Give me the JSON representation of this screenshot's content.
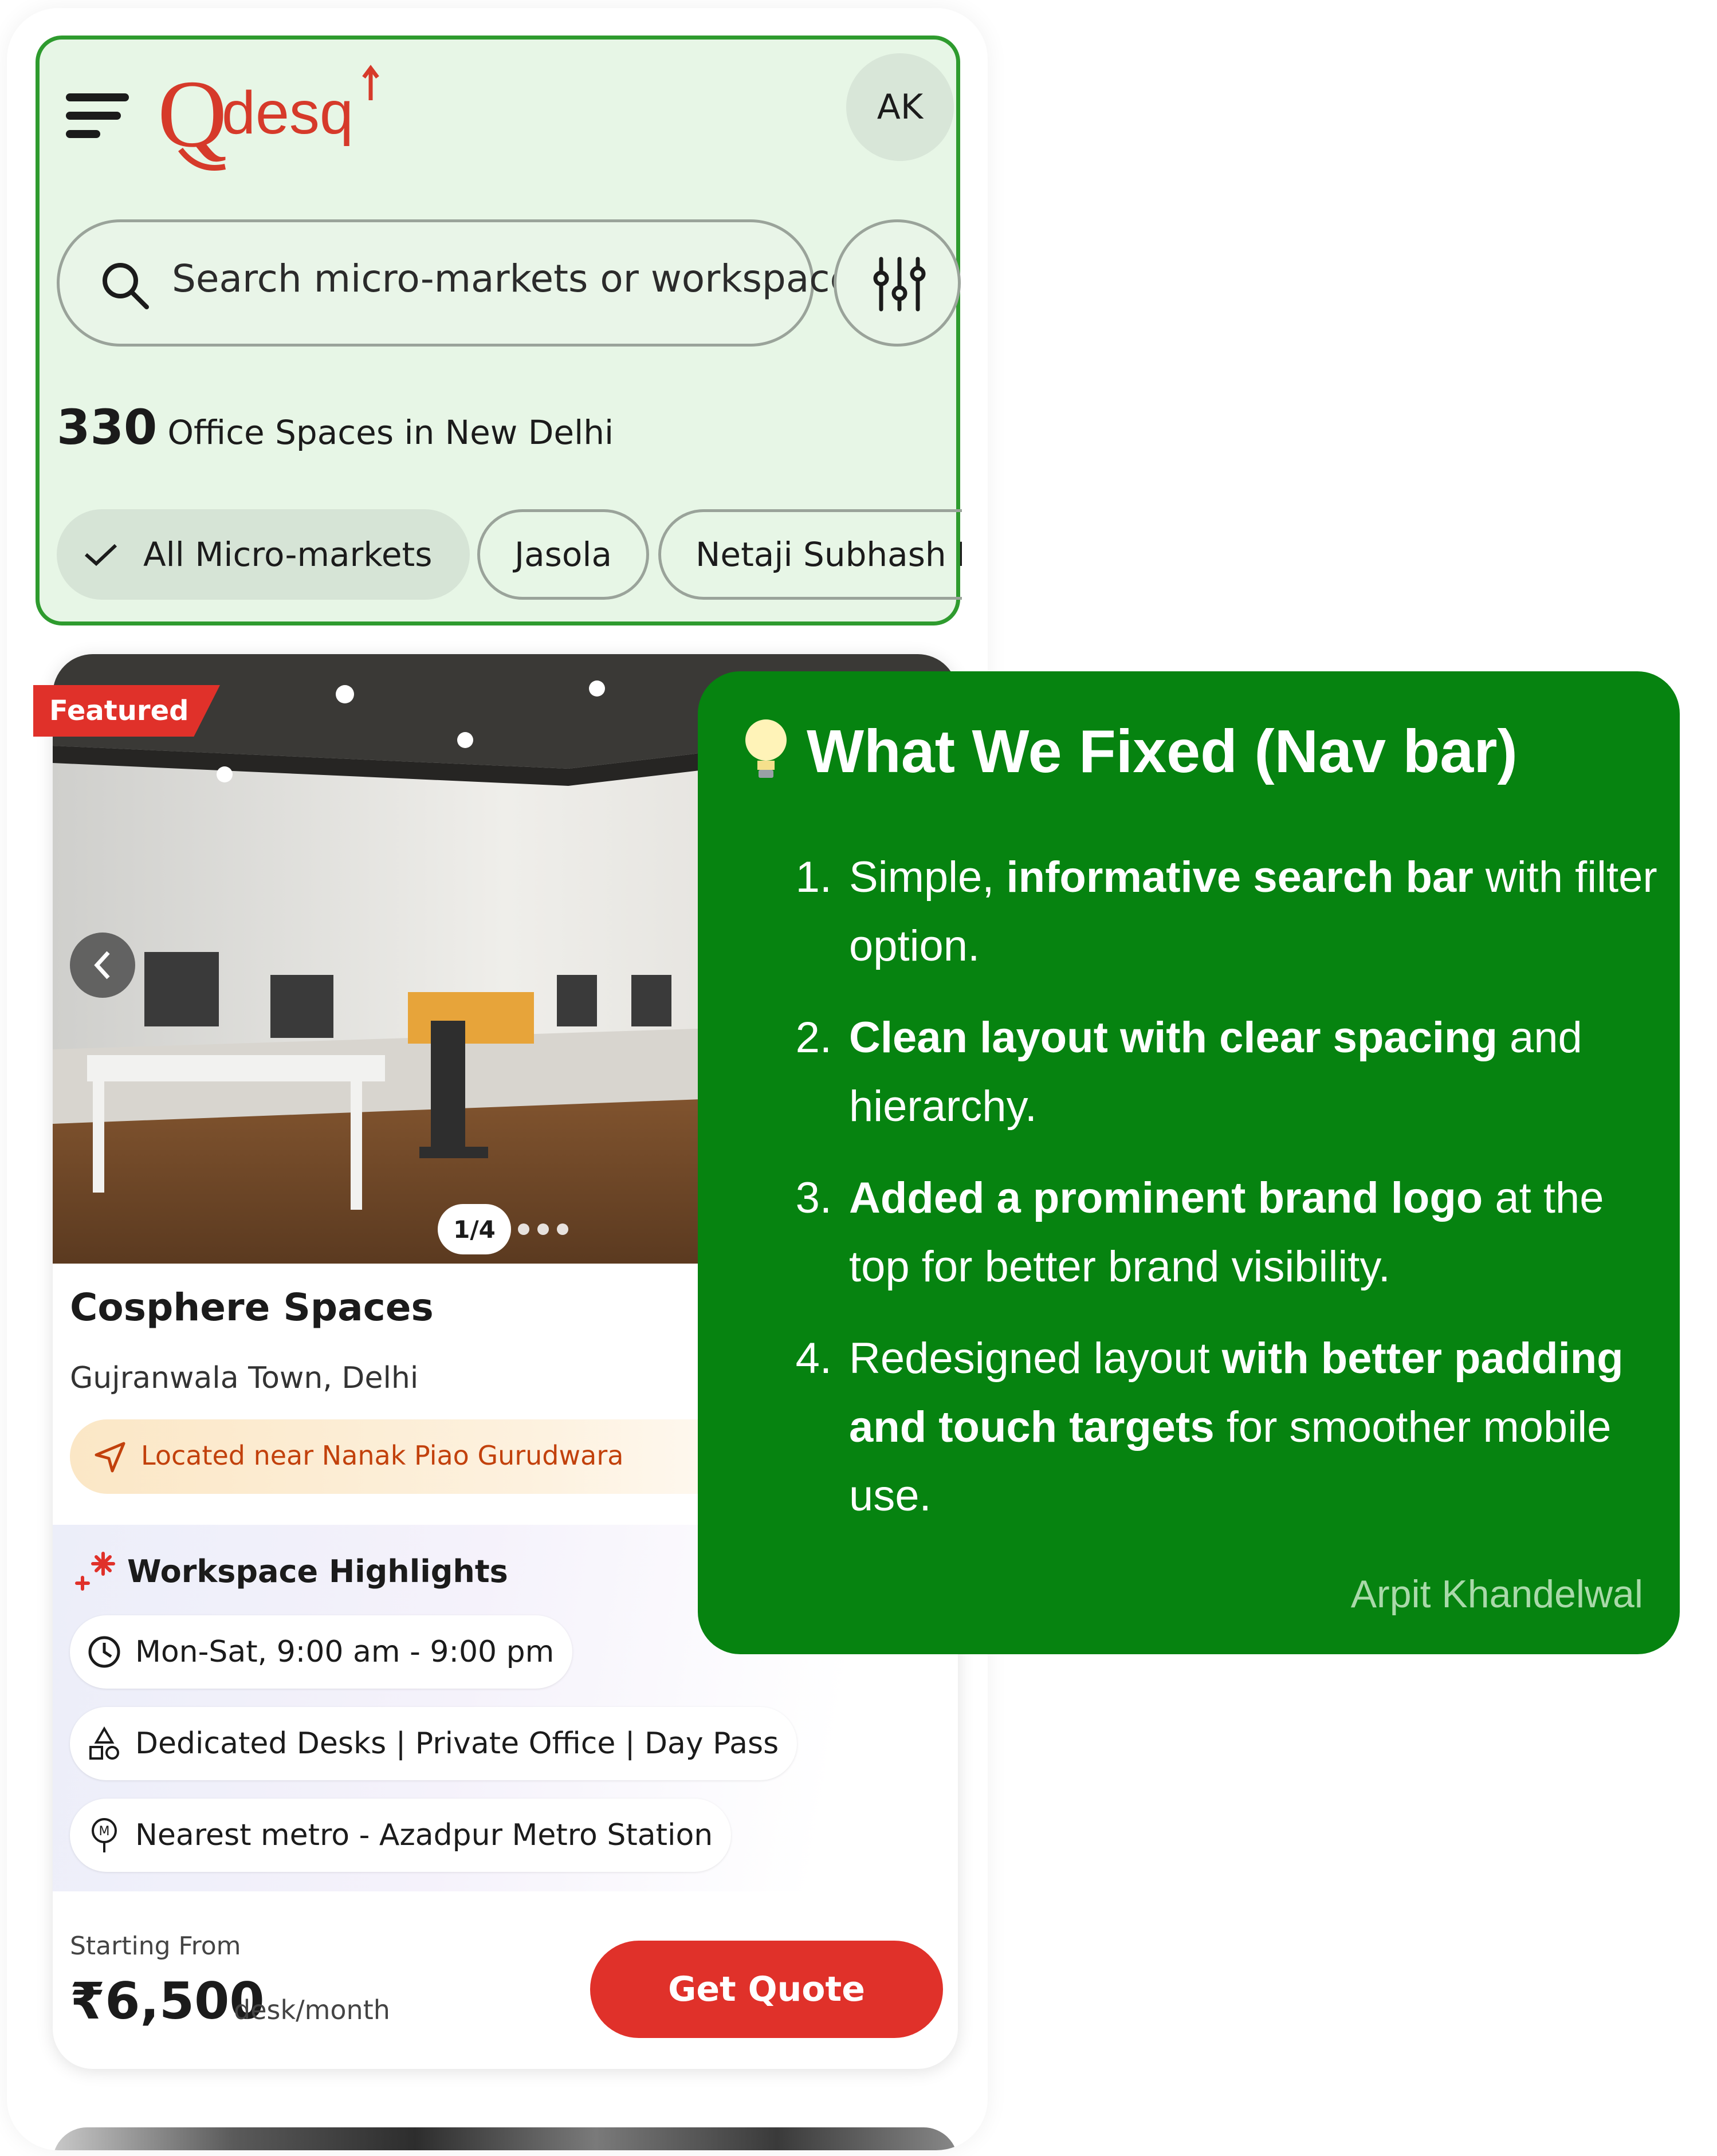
{
  "header": {
    "brand": "Qdesq",
    "avatar_initials": "AK",
    "search_placeholder": "Search micro-markets or workspace",
    "result_count": "330",
    "result_label": "Office Spaces in New Delhi",
    "chips": [
      {
        "label": "All Micro-markets",
        "selected": true
      },
      {
        "label": "Jasola",
        "selected": false
      },
      {
        "label": "Netaji Subhash Place",
        "selected": false
      }
    ]
  },
  "listing": {
    "badge": "Featured",
    "image_pager": "1/4",
    "title": "Cosphere Spaces",
    "location": "Gujranwala Town, Delhi",
    "near_label": "Located near Nanak Piao Gurudwara",
    "highlights_title": "Workspace Highlights",
    "highlights": [
      {
        "icon": "clock-icon",
        "text": "Mon-Sat, 9:00 am - 9:00 pm"
      },
      {
        "icon": "shapes-icon",
        "text": "Dedicated Desks | Private Office | Day Pass"
      },
      {
        "icon": "metro-icon",
        "text": "Nearest metro - Azadpur Metro Station"
      }
    ],
    "starting_label": "Starting From",
    "price": "₹6,500",
    "price_unit": "desk/month",
    "cta": "Get Quote"
  },
  "panel": {
    "title": "What We Fixed (Nav bar)",
    "points": [
      {
        "num": "1.",
        "pre": "Simple, ",
        "bold": "informative search bar",
        "post": " with filter option."
      },
      {
        "num": "2.",
        "pre": "",
        "bold": "Clean layout with clear spacing",
        "post": " and hierarchy."
      },
      {
        "num": "3.",
        "pre": "",
        "bold": "Added a prominent brand logo",
        "post": " at the top for better brand visibility."
      },
      {
        "num": "4.",
        "pre": "Redesigned layout ",
        "bold": "with better padding and touch targets",
        "post": " for smoother mobile use."
      }
    ],
    "author": "Arpit Khandelwal"
  },
  "colors": {
    "brand_red": "#e0312a",
    "highlight_green": "#2e9b2e",
    "panel_green": "#068310"
  }
}
